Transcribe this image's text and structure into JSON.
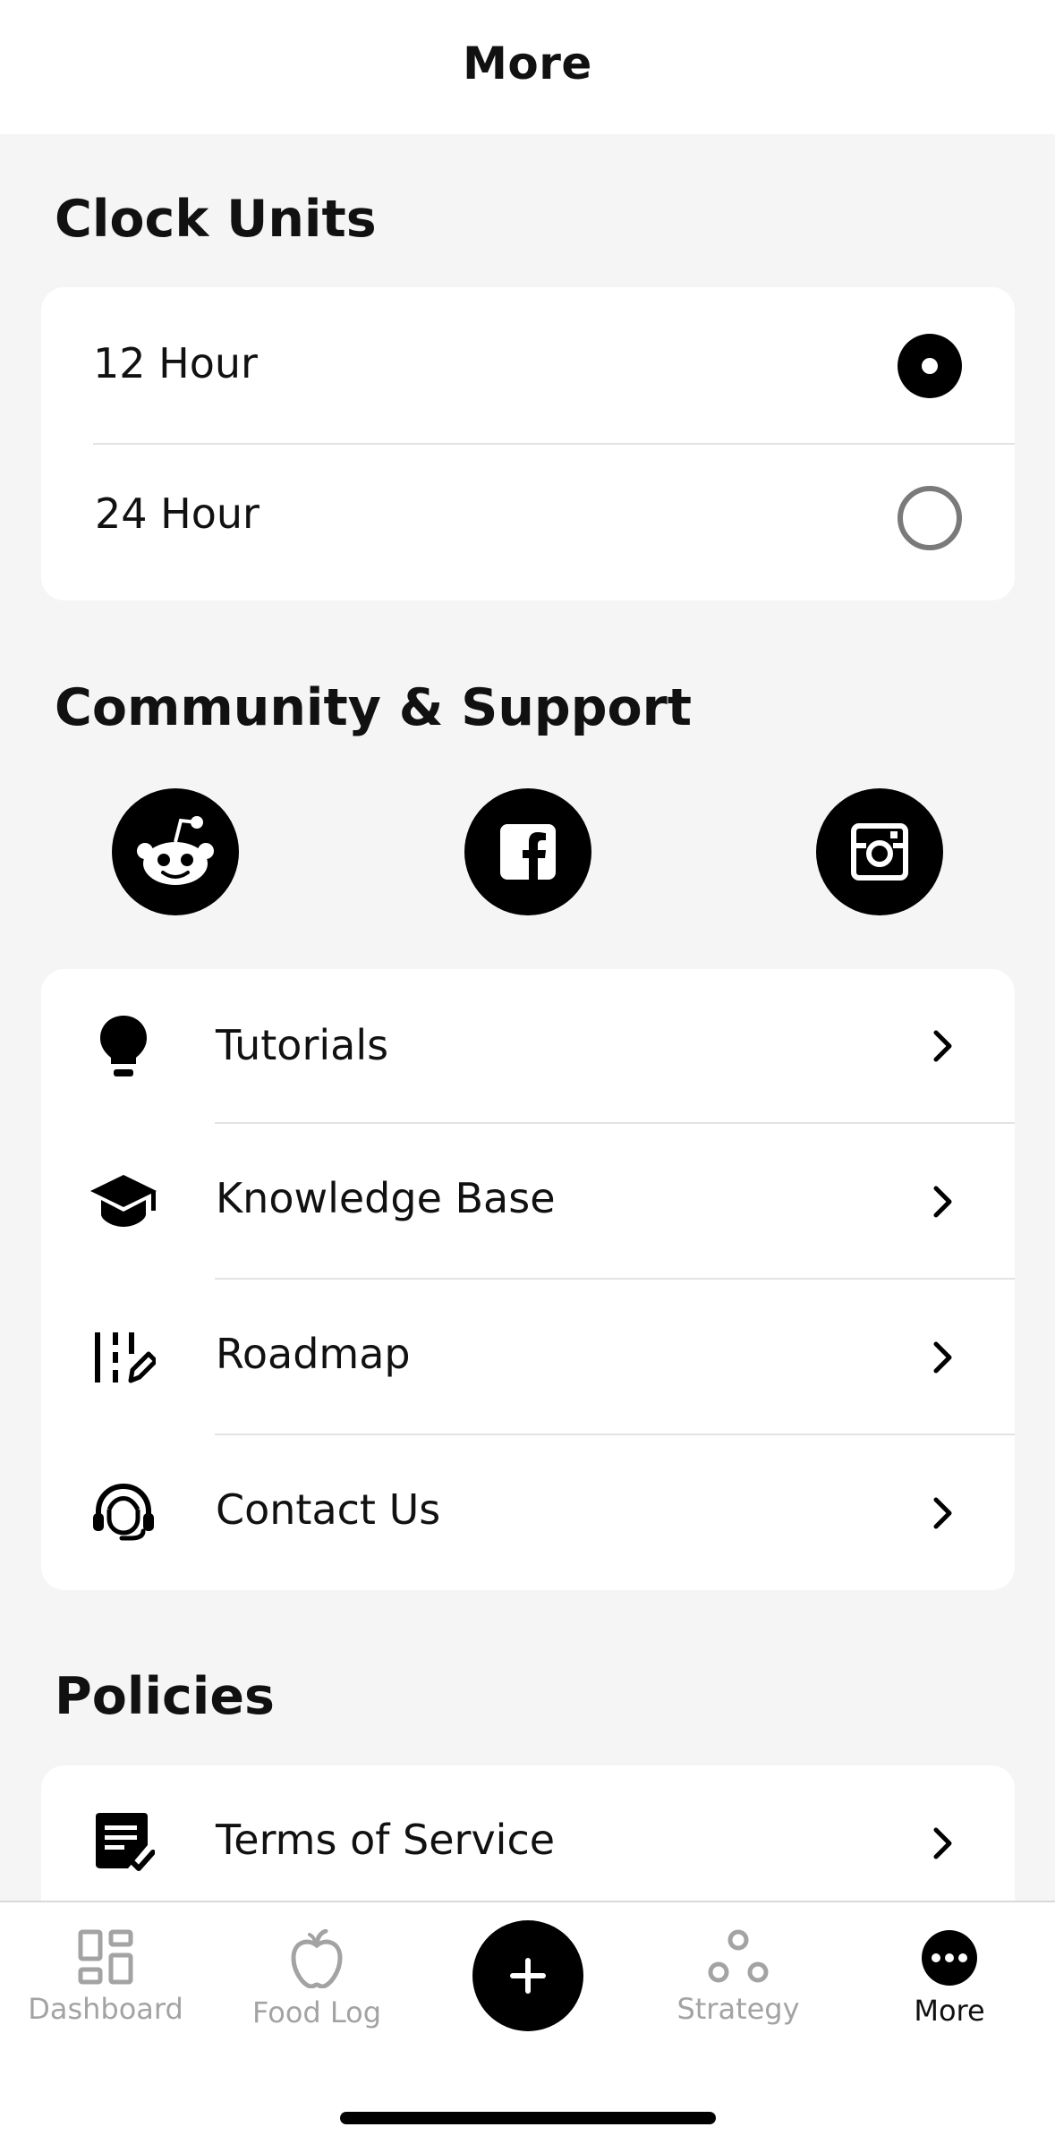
{
  "header": {
    "title": "More"
  },
  "clock_units": {
    "title": "Clock Units",
    "options": [
      {
        "label": "12 Hour",
        "selected": true
      },
      {
        "label": "24 Hour",
        "selected": false
      }
    ]
  },
  "community": {
    "title": "Community & Support",
    "social": [
      "reddit-icon",
      "facebook-icon",
      "instagram-icon"
    ],
    "items": [
      {
        "label": "Tutorials",
        "icon": "lightbulb-icon"
      },
      {
        "label": "Knowledge Base",
        "icon": "graduation-cap-icon"
      },
      {
        "label": "Roadmap",
        "icon": "roadmap-icon"
      },
      {
        "label": "Contact Us",
        "icon": "headset-icon"
      }
    ]
  },
  "policies": {
    "title": "Policies",
    "items": [
      {
        "label": "Terms of Service",
        "icon": "document-check-icon"
      }
    ]
  },
  "tabbar": {
    "items": [
      {
        "label": "Dashboard",
        "icon": "dashboard-icon"
      },
      {
        "label": "Food Log",
        "icon": "apple-icon"
      },
      {
        "label": "",
        "icon": "plus-icon"
      },
      {
        "label": "Strategy",
        "icon": "strategy-icon"
      },
      {
        "label": "More",
        "icon": "more-icon"
      }
    ],
    "active": "More"
  }
}
